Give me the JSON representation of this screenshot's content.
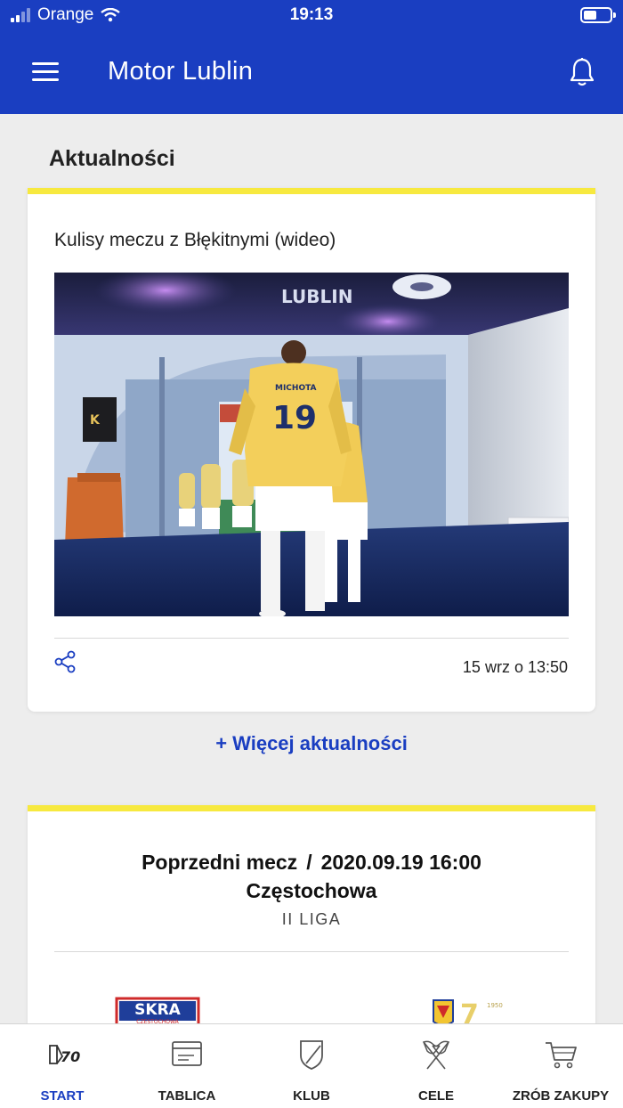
{
  "status_bar": {
    "carrier": "Orange",
    "time": "19:13"
  },
  "app_bar": {
    "title": "Motor Lublin"
  },
  "news_section": {
    "title": "Aktualności",
    "article": {
      "title": "Kulisy meczu z Błękitnymi (wideo)",
      "date": "15 wrz o 13:50",
      "photo": {
        "banner_text": "LUBLIN",
        "jersey_number": "19",
        "jersey_name": "MICHOTA"
      }
    },
    "more_link": "+ Więcej aktualności"
  },
  "match": {
    "label": "Poprzedni mecz",
    "separator": "/",
    "datetime": "2020.09.19 16:00",
    "city": "Częstochowa",
    "league": "II LIGA",
    "home_logo_text": "SKRA",
    "home_logo_subtext": "CZĘSTOCHOWA"
  },
  "tabs": [
    {
      "label": "START",
      "icon": "motor-70-logo-icon",
      "active": true
    },
    {
      "label": "TABLICA",
      "icon": "board-icon",
      "active": false
    },
    {
      "label": "KLUB",
      "icon": "shield-icon",
      "active": false
    },
    {
      "label": "CELE",
      "icon": "flags-icon",
      "active": false
    },
    {
      "label": "ZRÓB ZAKUPY",
      "icon": "cart-icon",
      "active": false
    }
  ],
  "colors": {
    "primary": "#1a3ec1",
    "accent": "#f7e93f",
    "background": "#ededed"
  }
}
